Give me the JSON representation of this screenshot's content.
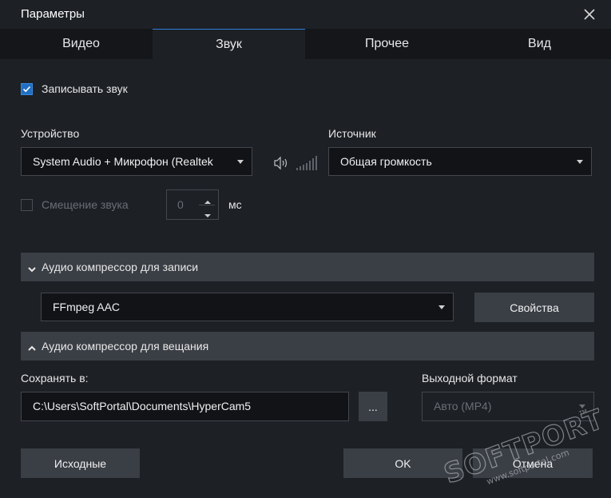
{
  "window": {
    "title": "Параметры"
  },
  "tabs": [
    {
      "label": "Видео",
      "active": false
    },
    {
      "label": "Звук",
      "active": true
    },
    {
      "label": "Прочее",
      "active": false
    },
    {
      "label": "Вид",
      "active": false
    }
  ],
  "record_sound": {
    "label": "Записывать звук",
    "checked": true
  },
  "device": {
    "label": "Устройство",
    "value": "System Audio + Микрофон (Realtek"
  },
  "source": {
    "label": "Источник",
    "value": "Общая громкость"
  },
  "offset": {
    "label": "Смещение звука",
    "checked": false,
    "value": "0",
    "unit": "мс"
  },
  "record_compressor": {
    "label": "Аудио компрессор для записи",
    "expanded": true,
    "value": "FFmpeg AAC",
    "properties_label": "Свойства"
  },
  "broadcast_compressor": {
    "label": "Аудио компрессор для вещания",
    "expanded": false
  },
  "save_to": {
    "label": "Сохранять в:",
    "value": "C:\\Users\\SoftPortal\\Documents\\HyperCam5",
    "browse_label": "..."
  },
  "output_format": {
    "label": "Выходной формат",
    "value": "Авто (MP4)"
  },
  "footer": {
    "defaults_label": "Исходные",
    "ok_label": "OK",
    "cancel_label": "Отмена"
  },
  "watermark": {
    "brand": "SOFTPORTAL",
    "url": "www.softportal.com",
    "mark": "TM"
  },
  "colors": {
    "accent": "#2b7fd6",
    "background": "#1d2025",
    "panel": "#3a3e45"
  }
}
